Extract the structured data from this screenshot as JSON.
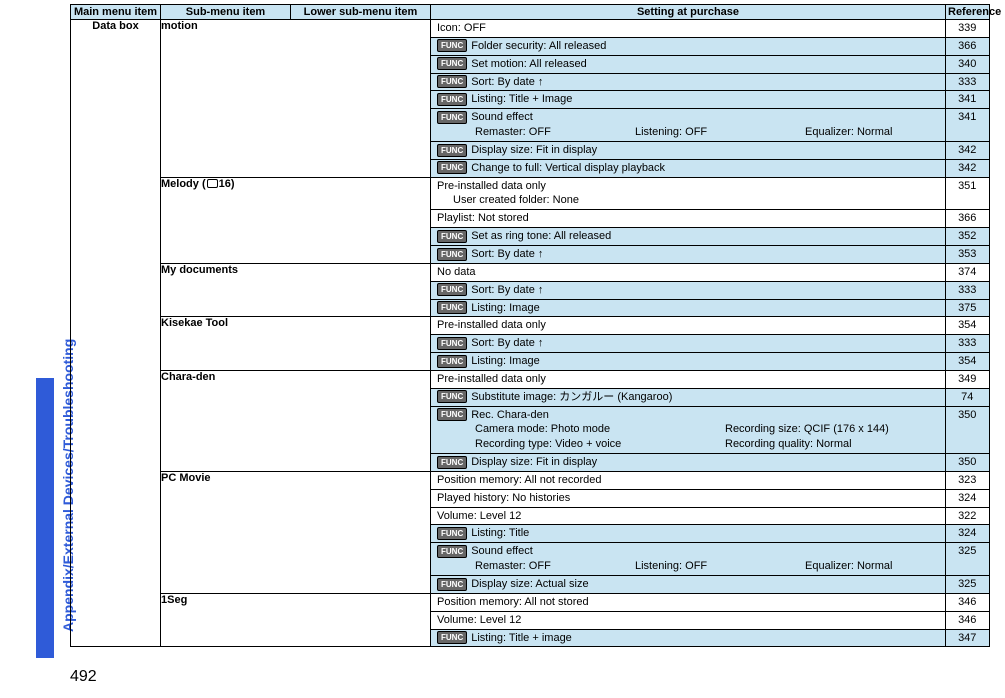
{
  "side_tab": "Appendix/External Devices/Troubleshooting",
  "page_number": "492",
  "func_label": "FUNC",
  "headers": {
    "main": "Main menu item",
    "sub": "Sub-menu item",
    "lower": "Lower sub-menu item",
    "setting": "Setting at purchase",
    "ref": "Reference"
  },
  "main_item": "Data box",
  "groups": [
    {
      "sub": " motion",
      "sub_prefix_icon": "i",
      "rows": [
        {
          "text": "Icon: OFF",
          "ref": "339",
          "func": false
        },
        {
          "text": "Folder security: All released",
          "ref": "366",
          "func": true
        },
        {
          "text": "Set   motion: All released",
          "ref": "340",
          "func": true
        },
        {
          "text": "Sort: By date ↑",
          "ref": "333",
          "func": true
        },
        {
          "text": "Listing: Title + Image",
          "ref": "341",
          "func": true
        },
        {
          "text": "Sound effect",
          "ref": "341",
          "func": true,
          "extra": [
            {
              "type": "cols3",
              "items": [
                "Remaster: OFF",
                "Listening: OFF",
                "Equalizer: Normal"
              ]
            }
          ]
        },
        {
          "text": "Display size: Fit in display",
          "ref": "342",
          "func": true
        },
        {
          "text": "Change to full: Vertical display playback",
          "ref": "342",
          "func": true
        }
      ]
    },
    {
      "sub_html": "Melody (<span class=\"melody-square\"></span>16)",
      "rows": [
        {
          "text": "Pre-installed data only",
          "ref": "351",
          "func": false,
          "extra": [
            {
              "type": "plain",
              "text": "User created folder: None"
            }
          ]
        },
        {
          "text": "Playlist: Not stored",
          "ref": "366",
          "func": false
        },
        {
          "text": "Set as ring tone: All released",
          "ref": "352",
          "func": true
        },
        {
          "text": "Sort: By date ↑",
          "ref": "353",
          "func": true
        }
      ]
    },
    {
      "sub": "My documents",
      "rows": [
        {
          "text": "No data",
          "ref": "374",
          "func": false
        },
        {
          "text": "Sort: By date ↑",
          "ref": "333",
          "func": true
        },
        {
          "text": "Listing: Image",
          "ref": "375",
          "func": true
        }
      ]
    },
    {
      "sub": "Kisekae Tool",
      "rows": [
        {
          "text": "Pre-installed data only",
          "ref": "354",
          "func": false
        },
        {
          "text": "Sort: By date ↑",
          "ref": "333",
          "func": true
        },
        {
          "text": "Listing: Image",
          "ref": "354",
          "func": true
        }
      ]
    },
    {
      "sub": "Chara-den",
      "rows": [
        {
          "text": "Pre-installed data only",
          "ref": "349",
          "func": false
        },
        {
          "text": "Substitute image: カンガルー (Kangaroo)",
          "ref": "74",
          "func": true
        },
        {
          "text": "Rec. Chara-den",
          "ref": "350",
          "func": true,
          "extra": [
            {
              "type": "cols2",
              "items": [
                "Camera mode: Photo mode",
                "Recording size: QCIF (176 x 144)"
              ]
            },
            {
              "type": "cols2",
              "items": [
                "Recording type: Video + voice",
                "Recording quality: Normal"
              ]
            }
          ]
        },
        {
          "text": "Display size: Fit in display",
          "ref": "350",
          "func": true
        }
      ]
    },
    {
      "sub": "PC Movie",
      "rows": [
        {
          "text": "Position memory: All not recorded",
          "ref": "323",
          "func": false
        },
        {
          "text": "Played history: No histories",
          "ref": "324",
          "func": false
        },
        {
          "text": "Volume: Level 12",
          "ref": "322",
          "func": false
        },
        {
          "text": "Listing: Title",
          "ref": "324",
          "func": true
        },
        {
          "text": "Sound effect",
          "ref": "325",
          "func": true,
          "extra": [
            {
              "type": "cols3",
              "items": [
                "Remaster: OFF",
                "Listening: OFF",
                "Equalizer: Normal"
              ]
            }
          ]
        },
        {
          "text": "Display size: Actual size",
          "ref": "325",
          "func": true
        }
      ]
    },
    {
      "sub": "1Seg",
      "rows": [
        {
          "text": "Position memory: All not stored",
          "ref": "346",
          "func": false
        },
        {
          "text": "Volume: Level 12",
          "ref": "346",
          "func": false
        },
        {
          "text": "Listing: Title + image",
          "ref": "347",
          "func": true
        }
      ]
    }
  ]
}
